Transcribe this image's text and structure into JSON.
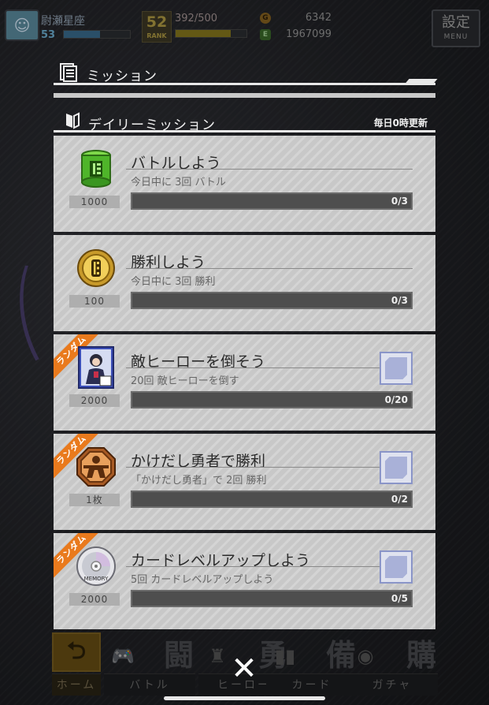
{
  "hud": {
    "player_name": "尉瀬星座",
    "level": "53",
    "level_progress": 0.55,
    "rank_value": "52",
    "rank_label": "RANK",
    "stamina": "392/500",
    "stamina_progress": 0.78,
    "coins": "6342",
    "gems": "1967099",
    "settings_label": "設定",
    "menu_label": "MENU"
  },
  "panel": {
    "title": "ミッション",
    "section_title": "デイリーミッション",
    "reset_note": "毎日0時更新"
  },
  "missions": [
    {
      "title": "バトルしよう",
      "desc": "今日中に 3回 バトル",
      "reward_count": "1000",
      "progress": "0/3",
      "progress_ratio": 0,
      "random": false,
      "reward_icon": "green-can-icon"
    },
    {
      "title": "勝利しよう",
      "desc": "今日中に 3回 勝利",
      "reward_count": "100",
      "progress": "0/3",
      "progress_ratio": 0,
      "random": false,
      "reward_icon": "gold-medal-icon"
    },
    {
      "title": "敵ヒーローを倒そう",
      "desc": "20回 敵ヒーローを倒す",
      "reward_count": "2000",
      "progress": "0/20",
      "progress_ratio": 0,
      "random": true,
      "reward_icon": "hero-card-icon"
    },
    {
      "title": "かけだし勇者で勝利",
      "desc": "「かけだし勇者」で 2回 勝利",
      "reward_count": "1枚",
      "progress": "0/2",
      "progress_ratio": 0,
      "random": true,
      "reward_icon": "hero-badge-icon"
    },
    {
      "title": "カードレベルアップしよう",
      "desc": "5回 カードレベルアップしよう",
      "reward_count": "2000",
      "progress": "0/5",
      "progress_ratio": 0,
      "random": true,
      "reward_icon": "memory-disc-icon"
    }
  ],
  "ribbon_label": "ランダム",
  "nav": {
    "tabs": [
      {
        "label": "ホーム",
        "big": ""
      },
      {
        "label": "バトル",
        "big": "闘"
      },
      {
        "label": "ヒーロー",
        "big": "勇"
      },
      {
        "label": "カード",
        "big": "備"
      },
      {
        "label": "ガチャ",
        "big": "購"
      }
    ]
  },
  "hero_card_label": "防",
  "memory_label": "MEMORY",
  "close_label": "✕"
}
